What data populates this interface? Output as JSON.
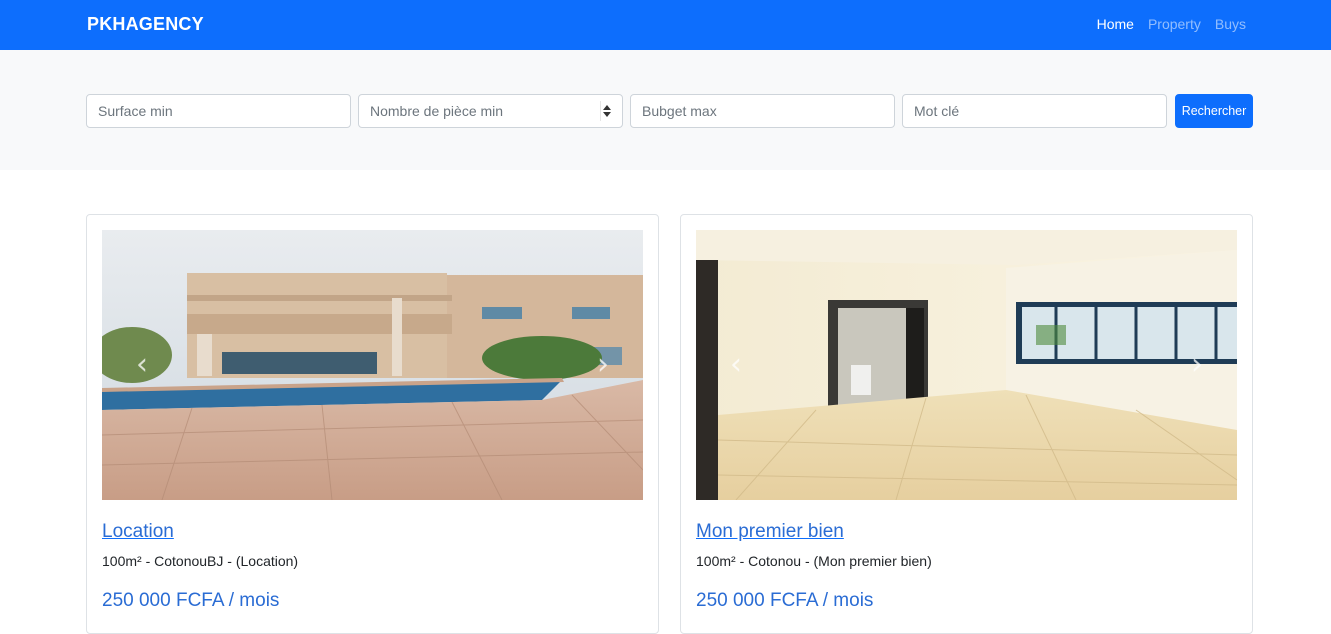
{
  "navbar": {
    "brand": "PKHAGENCY",
    "links": [
      {
        "label": "Home",
        "active": true
      },
      {
        "label": "Property",
        "active": false
      },
      {
        "label": "Buys",
        "active": false
      }
    ]
  },
  "search": {
    "surface_placeholder": "Surface min",
    "rooms_placeholder": "Nombre de pièce min",
    "budget_placeholder": "Bubget max",
    "keyword_placeholder": "Mot clé",
    "submit_label": "Rechercher"
  },
  "listings": [
    {
      "title": "Location",
      "meta": "100m² - CotonouBJ - (Location)",
      "price": "250 000 FCFA / mois",
      "prev_glyph": "‹",
      "next_glyph": "›"
    },
    {
      "title": "Mon premier bien",
      "meta": "100m² - Cotonou - (Mon premier bien)",
      "price": "250 000 FCFA / mois",
      "prev_glyph": "‹",
      "next_glyph": "›"
    }
  ],
  "colors": {
    "primary": "#0d6efd",
    "search_band": "#f8f9fa",
    "link": "#2a6cd4"
  }
}
